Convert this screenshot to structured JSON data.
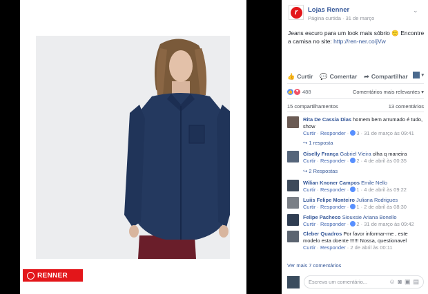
{
  "brand": {
    "logo_text": "RENNER",
    "primary_color": "#e3161a"
  },
  "post": {
    "page_name": "Lojas Renner",
    "meta_label": "Página curtida",
    "meta_date": "31 de março",
    "text": "Jeans escuro para um look mais sóbrio",
    "text_emoji": "🙂",
    "text2": "Encontre a camisa no site:",
    "link": "http://ren-ner.co/jVw"
  },
  "actions": {
    "like": "Curtir",
    "comment": "Comentar",
    "share": "Compartilhar"
  },
  "reactions": {
    "count": "488",
    "sort_label": "Comentários mais relevantes"
  },
  "summary": {
    "shares": "15 compartilhamentos",
    "comments": "13 comentários"
  },
  "comments": [
    {
      "name": "Rita De Cassia Dias",
      "tag": "",
      "text": "homem bem arrumado é tudo, show",
      "like": "Curtir",
      "reply": "Responder",
      "likes": "3",
      "date": "31 de março às 09:41",
      "replies": "1 resposta"
    },
    {
      "name": "Giselly França",
      "tag": "Gabriel Vieira",
      "text": "olha q maneira",
      "like": "Curtir",
      "reply": "Responder",
      "likes": "2",
      "date": "4 de abril às 00:35",
      "replies": "2 Respostas"
    },
    {
      "name": "Wilian Knoner Campos",
      "tag": "Emile Nello",
      "text": "",
      "like": "Curtir",
      "reply": "Responder",
      "likes": "1",
      "date": "4 de abril às 09:22",
      "replies": ""
    },
    {
      "name": "Luiis Felipe Monteiro",
      "tag": "Juliana Rodrigues",
      "text": "",
      "like": "Curtir",
      "reply": "Responder",
      "likes": "1",
      "date": "2 de abril às 08:30",
      "replies": ""
    },
    {
      "name": "Felipe Pacheco",
      "tag": "Siouxsie Ariana Bonello",
      "text": "",
      "like": "Curtir",
      "reply": "Responder",
      "likes": "2",
      "date": "31 de março às 09:42",
      "replies": ""
    },
    {
      "name": "Cleber Quadros",
      "tag": "",
      "text": "Por favor informar-me , este modelo esta doente !!!!!! Nossa, questionavel",
      "like": "Curtir",
      "reply": "Responder",
      "likes": "",
      "date": "2 de abril às 00:11",
      "replies": ""
    }
  ],
  "more_comments": "Ver mais 7 comentários",
  "write": {
    "placeholder": "Escreva um comentário..."
  },
  "icons": [
    "chevron-down-icon",
    "like-icon",
    "comment-icon",
    "share-icon",
    "reaction-like-icon",
    "reaction-love-icon",
    "reply-arrow-icon",
    "emoji-icon",
    "camera-icon",
    "gif-icon",
    "sticker-icon"
  ]
}
